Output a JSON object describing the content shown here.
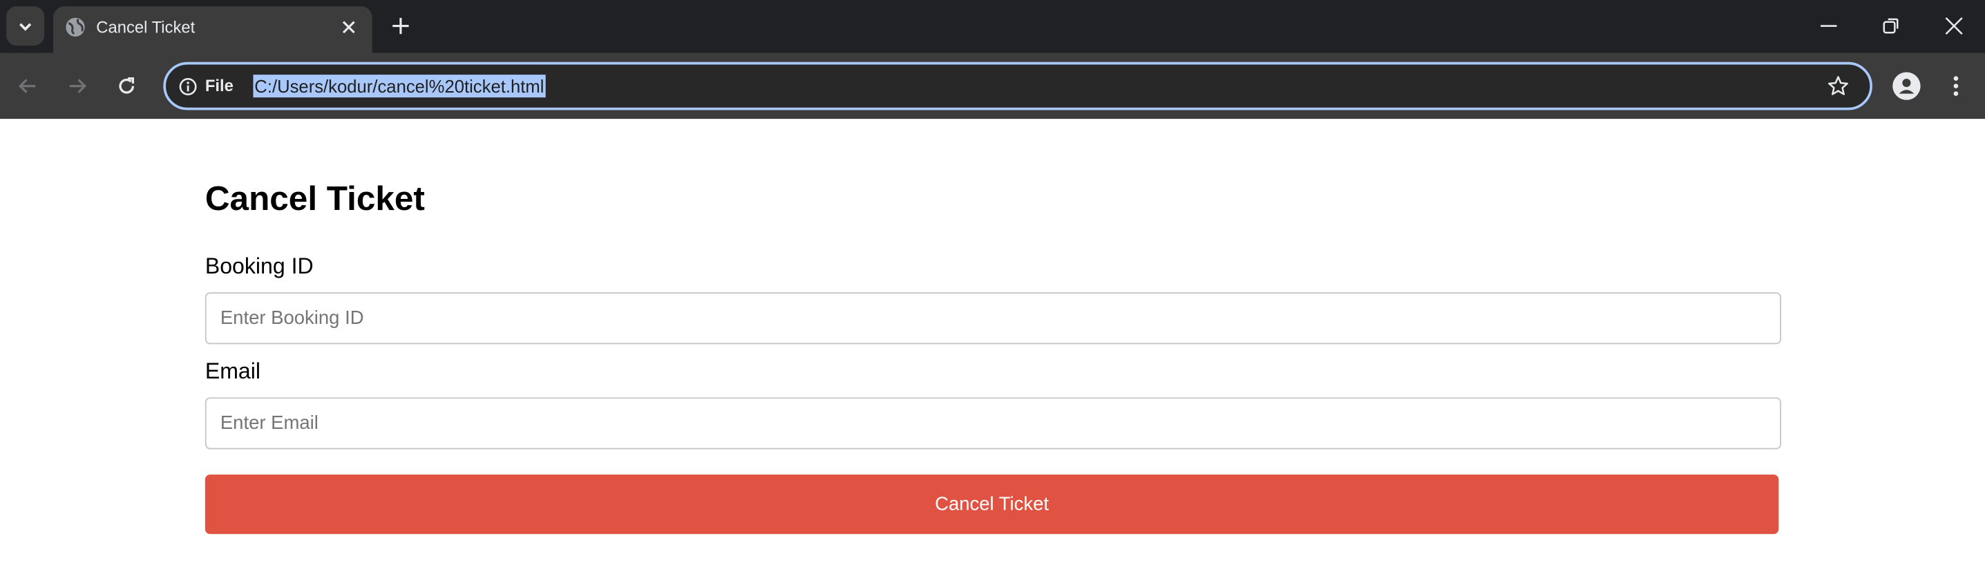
{
  "browser": {
    "tab": {
      "title": "Cancel Ticket"
    },
    "address_bar": {
      "scheme_label": "File",
      "url": "C:/Users/kodur/cancel%20ticket.html"
    }
  },
  "page": {
    "heading": "Cancel Ticket",
    "booking_id": {
      "label": "Booking ID",
      "placeholder": "Enter Booking ID",
      "value": ""
    },
    "email": {
      "label": "Email",
      "placeholder": "Enter Email",
      "value": ""
    },
    "submit_label": "Cancel Ticket"
  },
  "colors": {
    "accent": "#e05242",
    "focus_ring": "#a8c7fa",
    "tab_strip": "#202124",
    "toolbar": "#3c3c3c"
  }
}
